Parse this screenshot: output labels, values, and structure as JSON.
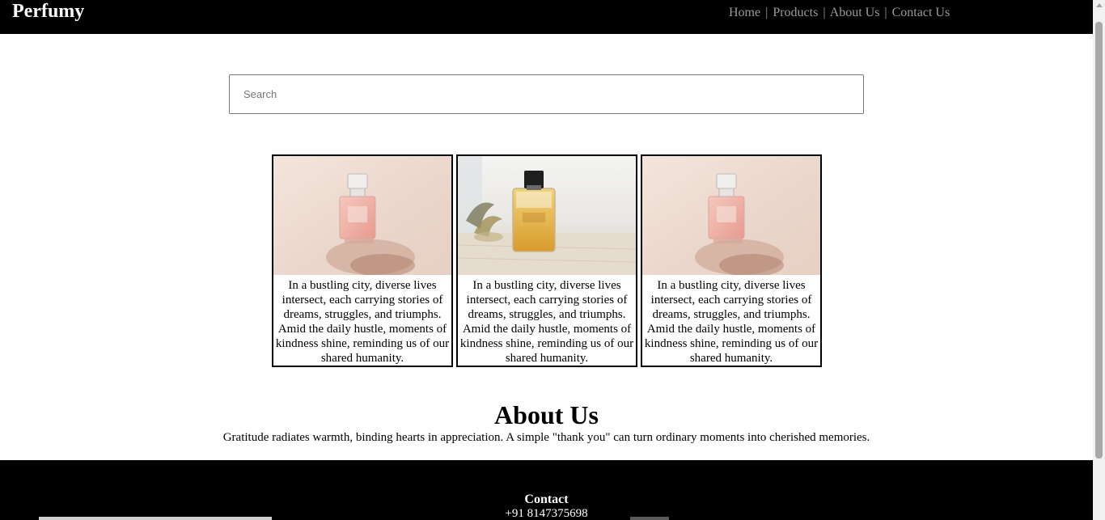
{
  "header": {
    "brand": "Perfumy",
    "nav": [
      {
        "label": "Home"
      },
      {
        "label": "Products"
      },
      {
        "label": "About Us"
      },
      {
        "label": "Contact Us"
      }
    ],
    "separator": "|"
  },
  "search": {
    "placeholder": "Search",
    "value": ""
  },
  "products": [
    {
      "image_icon": "perfume-bottle-pink",
      "description": "In a bustling city, diverse lives intersect, each carrying stories of dreams, struggles, and triumphs. Amid the daily hustle, moments of kindness shine, reminding us of our shared humanity."
    },
    {
      "image_icon": "perfume-bottle-amber",
      "description": "In a bustling city, diverse lives intersect, each carrying stories of dreams, struggles, and triumphs. Amid the daily hustle, moments of kindness shine, reminding us of our shared humanity."
    },
    {
      "image_icon": "perfume-bottle-pink",
      "description": "In a bustling city, diverse lives intersect, each carrying stories of dreams, struggles, and triumphs. Amid the daily hustle, moments of kindness shine, reminding us of our shared humanity."
    }
  ],
  "about": {
    "title": "About Us",
    "text": "Gratitude radiates warmth, binding hearts in appreciation. A simple \"thank you\" can turn ordinary moments into cherished memories."
  },
  "footer": {
    "contact_title": "Contact",
    "phone": "+91 8147375698"
  },
  "colors": {
    "nav_bg": "#000000",
    "nav_link": "#9a9a9a",
    "card_border": "#000000"
  }
}
